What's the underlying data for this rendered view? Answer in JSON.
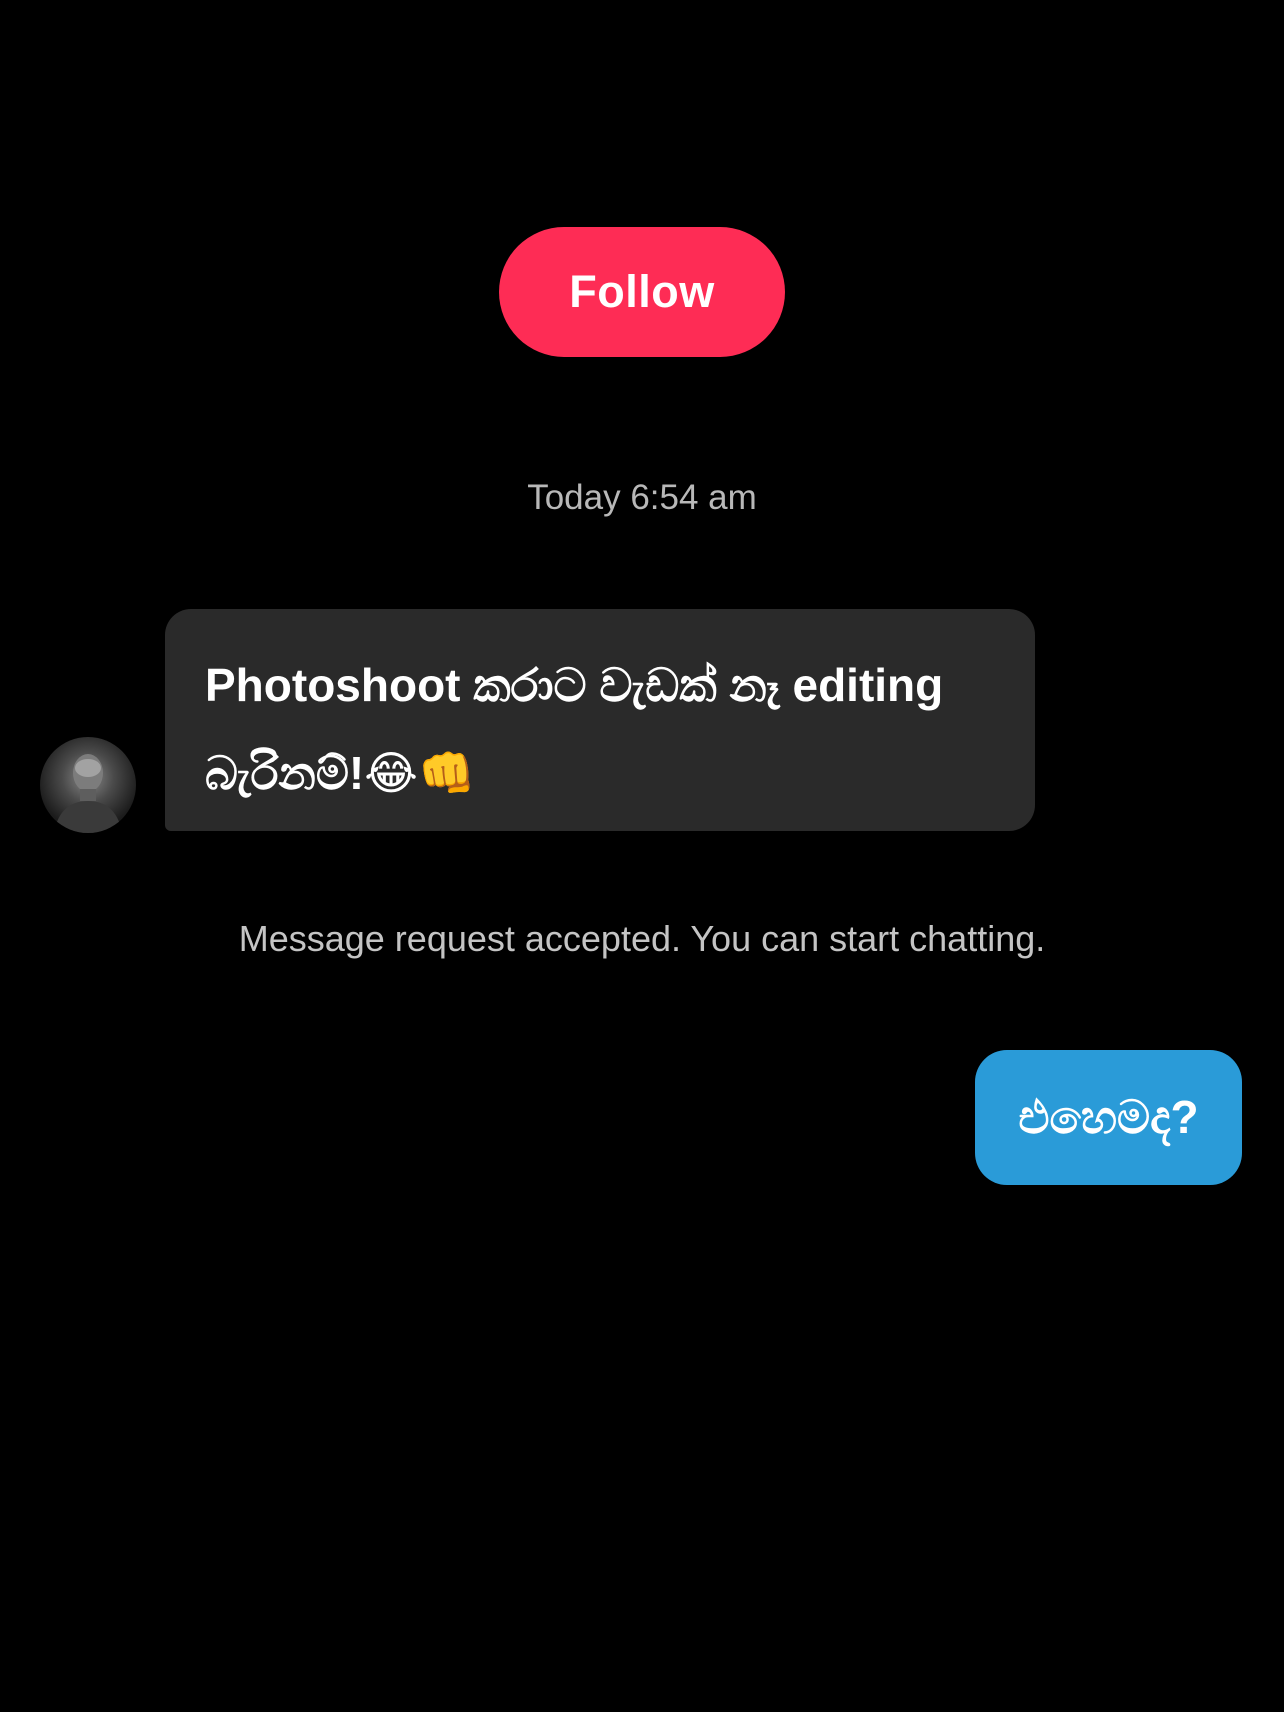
{
  "header": {
    "follow_label": "Follow",
    "follow_color": "#fe2c55"
  },
  "chat": {
    "timestamp": "Today 6:54 am",
    "incoming": {
      "avatar_icon": "profile-photo-avatar",
      "line1": "Photoshoot කරාට වැඩක් නෑ editing",
      "line2": "බැරිනම්!😂👊"
    },
    "system_note": "Message request accepted. You can start chatting.",
    "outgoing": {
      "text": "එහෙමද?",
      "color": "#2a9bd8"
    }
  }
}
